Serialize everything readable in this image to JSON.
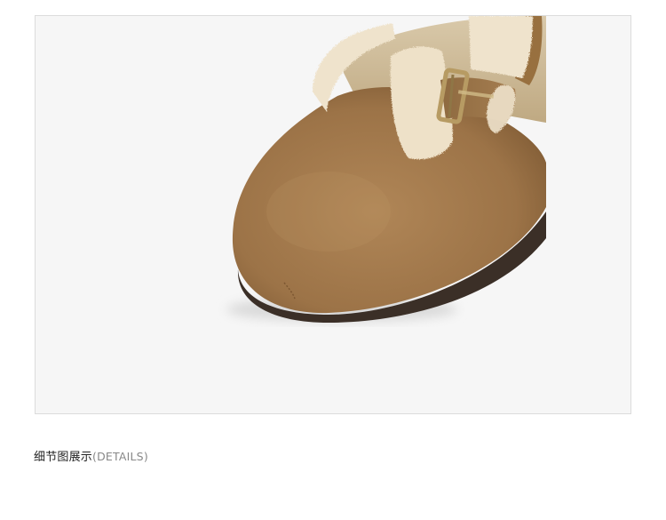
{
  "caption": {
    "title": "细节图展示",
    "subtitle": "(DETAILS)"
  },
  "colors": {
    "suede": "#a47b4d",
    "suede_dark": "#7e5a34",
    "fleece": "#efe3cc",
    "sole": "#3b2f27",
    "buckle": "#b79b63",
    "background": "#f6f6f6"
  }
}
